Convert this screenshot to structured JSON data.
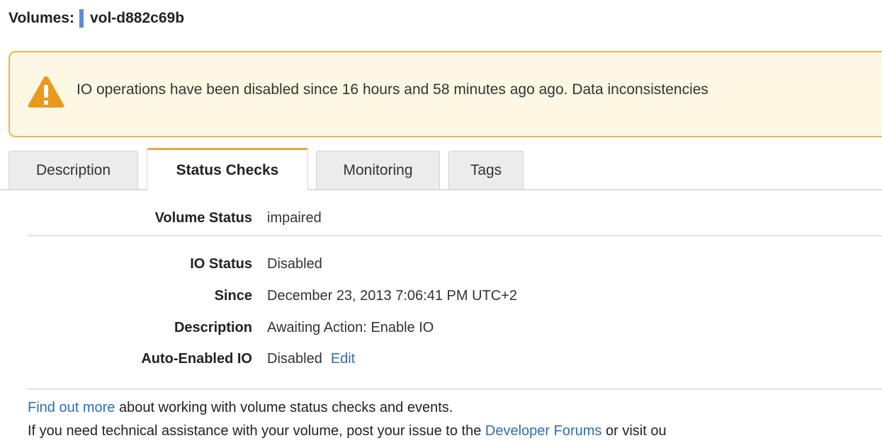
{
  "header": {
    "title": "Volumes:",
    "volume_id": "vol-d882c69b"
  },
  "banner": {
    "icon": "warning-triangle-icon",
    "message": "IO operations have been disabled since 16 hours and 58 minutes ago ago. Data inconsistencies"
  },
  "tabs": [
    {
      "label": "Description",
      "active": false
    },
    {
      "label": "Status Checks",
      "active": true
    },
    {
      "label": "Monitoring",
      "active": false
    },
    {
      "label": "Tags",
      "active": false
    }
  ],
  "details": {
    "volume_status": {
      "label": "Volume Status",
      "value": "impaired"
    },
    "io_status": {
      "label": "IO Status",
      "value": "Disabled"
    },
    "since": {
      "label": "Since",
      "value": "December 23, 2013 7:06:41 PM UTC+2"
    },
    "description": {
      "label": "Description",
      "value": "Awaiting Action: Enable IO"
    },
    "auto_enabled_io": {
      "label": "Auto-Enabled IO",
      "value": "Disabled",
      "edit_label": "Edit"
    }
  },
  "footer": {
    "line1": {
      "link_text": "Find out more",
      "rest": " about working with volume status checks and events."
    },
    "line2": {
      "prefix": "If you need technical assistance with your volume, post your issue to the ",
      "link_text": "Developer Forums",
      "suffix": " or visit ou"
    }
  },
  "colors": {
    "accent_tab": "#f2a33a",
    "banner_bg": "#fdf8e4",
    "banner_border": "#f2b34a",
    "warning_icon": "#e89a1c",
    "link": "#2f6db5",
    "id_marker": "#5a8ed6"
  }
}
